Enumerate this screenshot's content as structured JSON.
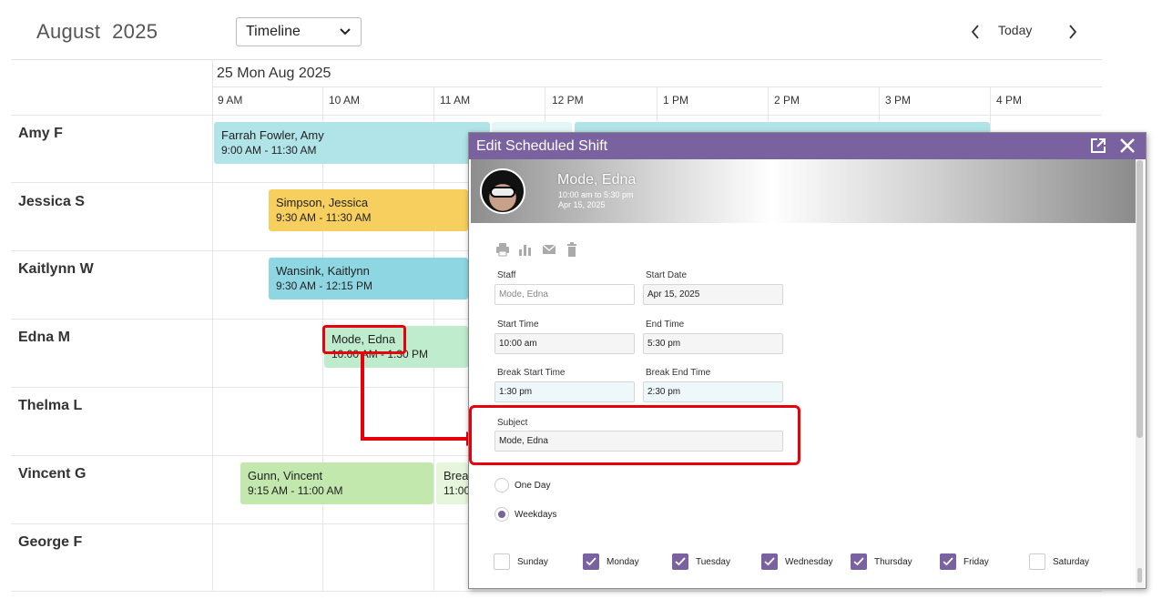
{
  "header": {
    "month": "August",
    "year": "2025",
    "view_value": "Timeline",
    "today_label": "Today"
  },
  "timeline": {
    "date": "25 Mon Aug 2025",
    "hours": [
      "9 AM",
      "10 AM",
      "11 AM",
      "12 PM",
      "1 PM",
      "2 PM",
      "3 PM",
      "4 PM"
    ],
    "rows": [
      "Amy F",
      "Jessica S",
      "Kaitlynn W",
      "Edna M",
      "Thelma L",
      "Vincent G",
      "George F"
    ]
  },
  "events": [
    {
      "name": "Farrah Fowler, Amy",
      "time": "9:00 AM - 11:30 AM",
      "color": "#b0e4e8"
    },
    {
      "name": "Simpson, Jessica",
      "time": "9:30 AM - 11:30 AM",
      "color": "#f7cf5e"
    },
    {
      "name": "Wansink, Kaitlynn",
      "time": "9:30 AM - 12:15 PM",
      "color": "#8fd6e3"
    },
    {
      "name": "Mode, Edna",
      "time": "10:00 AM - 1:30 PM",
      "color": "#bfeccd"
    },
    {
      "name": "Gunn, Vincent",
      "time": "9:15 AM - 11:00 AM",
      "color": "#c2e8ad"
    },
    {
      "name": "Brea",
      "time": "11:00",
      "color": "#e6f6dc"
    }
  ],
  "dialog": {
    "title": "Edit Scheduled Shift",
    "banner": {
      "name": "Mode, Edna",
      "time": "10:00 am to 5:30 pm",
      "date": "Apr 15, 2025"
    },
    "toolbar_icons": [
      "print-icon",
      "chart-icon",
      "mail-icon",
      "trash-icon"
    ],
    "fields": {
      "staff": {
        "label": "Staff",
        "placeholder": "Mode, Edna"
      },
      "start_date": {
        "label": "Start Date",
        "value": "Apr 15, 2025"
      },
      "start_time": {
        "label": "Start Time",
        "value": "10:00 am"
      },
      "end_time": {
        "label": "End Time",
        "value": "5:30 pm"
      },
      "break_start": {
        "label": "Break Start Time",
        "value": "1:30 pm"
      },
      "break_end": {
        "label": "Break End Time",
        "value": "2:30 pm"
      },
      "subject": {
        "label": "Subject",
        "value": "Mode, Edna"
      }
    },
    "recurrence": [
      {
        "label": "One Day",
        "selected": false
      },
      {
        "label": "Weekdays",
        "selected": true
      }
    ],
    "days": [
      {
        "label": "Sunday",
        "checked": false
      },
      {
        "label": "Monday",
        "checked": true
      },
      {
        "label": "Tuesday",
        "checked": true
      },
      {
        "label": "Wednesday",
        "checked": true
      },
      {
        "label": "Thursday",
        "checked": true
      },
      {
        "label": "Friday",
        "checked": true
      },
      {
        "label": "Saturday",
        "checked": false
      }
    ],
    "accent_color": "#7a62a0"
  },
  "annotation_color": "#e8000b"
}
